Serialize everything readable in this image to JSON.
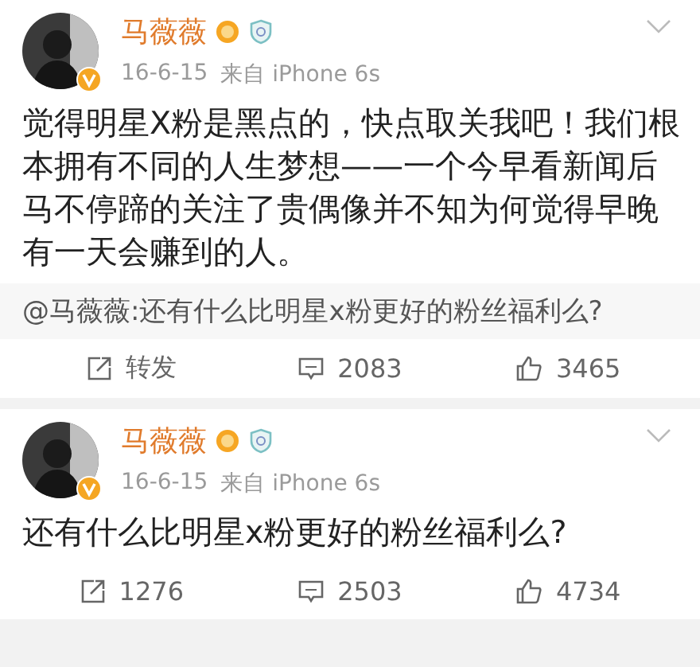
{
  "posts": [
    {
      "author": "马薇薇",
      "date": "16-6-15",
      "source": "来自 iPhone 6s",
      "text": "觉得明星X粉是黑点的，快点取关我吧！我们根本拥有不同的人生梦想——一个今早看新闻后马不停蹄的关注了贵偶像并不知为何觉得早晚有一天会赚到的人。",
      "quote": "@马薇薇:还有什么比明星x粉更好的粉丝福利么?",
      "reposts": "转发",
      "comments": "2083",
      "likes": "3465"
    },
    {
      "author": "马薇薇",
      "date": "16-6-15",
      "source": "来自 iPhone 6s",
      "text": "还有什么比明星x粉更好的粉丝福利么?",
      "reposts": "1276",
      "comments": "2503",
      "likes": "4734"
    }
  ]
}
